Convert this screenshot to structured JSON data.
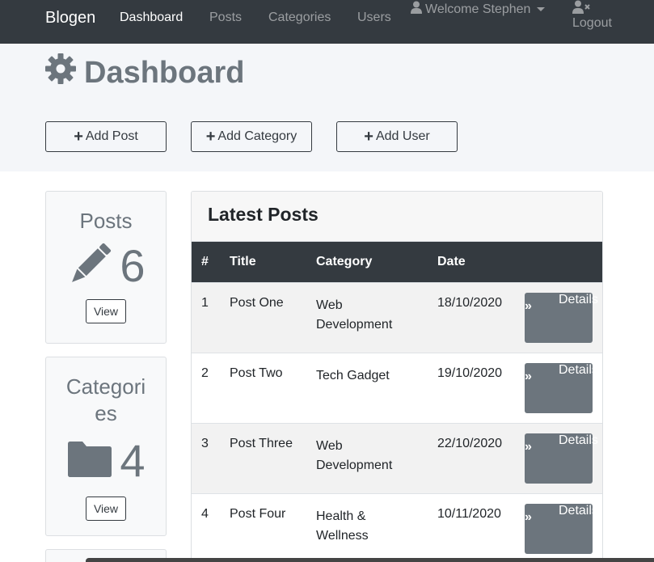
{
  "navbar": {
    "brand": "Blogen",
    "links": [
      "Dashboard",
      "Posts",
      "Categories",
      "Users"
    ],
    "user_label": "Welcome Stephen",
    "logout_label": "Logout",
    "icons": {
      "user": "user-icon",
      "logout": "user-times-icon",
      "caret": "caret-down-icon"
    }
  },
  "header": {
    "title": "Dashboard",
    "title_icon": "gear-icon",
    "actions": [
      "Add Post",
      "Add Category",
      "Add User"
    ]
  },
  "stats": [
    {
      "title": "Posts",
      "count": "6",
      "icon": "pencil-icon",
      "view_label": "View"
    },
    {
      "title": "Categori\nes",
      "count": "4",
      "icon": "folder-icon",
      "view_label": "View"
    }
  ],
  "posts": {
    "heading": "Latest Posts",
    "columns": [
      "#",
      "Title",
      "Category",
      "Date"
    ],
    "rows": [
      {
        "num": "1",
        "title": "Post One",
        "category": "Web Development",
        "date": "18/10/2020"
      },
      {
        "num": "2",
        "title": "Post Two",
        "category": "Tech Gadget",
        "date": "19/10/2020"
      },
      {
        "num": "3",
        "title": "Post Three",
        "category": "Web Development",
        "date": "22/10/2020"
      },
      {
        "num": "4",
        "title": "Post Four",
        "category": "Health & Wellness",
        "date": "10/11/2020"
      }
    ],
    "details_label": "Details",
    "details_icon": "angle-double-right-icon"
  },
  "colors": {
    "navbar": "#343a40",
    "header_bg": "#f4f6f9",
    "muted": "#6c757d",
    "details_button": "#6c757d"
  }
}
